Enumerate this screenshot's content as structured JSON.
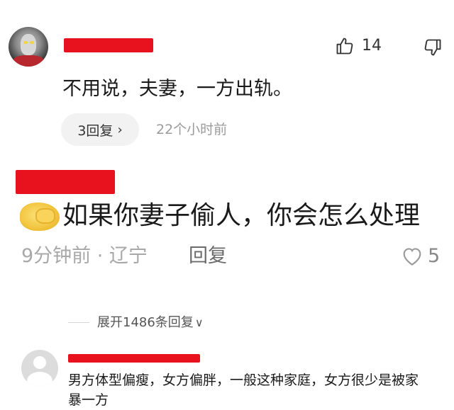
{
  "comment_top": {
    "username": "",
    "likes": "14",
    "text": "不用说，夫妻，一方出轨。",
    "reply_count_label": "3回复",
    "time": "22个小时前"
  },
  "comment_main": {
    "username": "",
    "text": "如果你妻子偷人，你会怎么处理",
    "meta": "9分钟前 · 辽宁",
    "reply_label": "回复",
    "likes": "5"
  },
  "expand_replies": {
    "label": "展开1486条回复"
  },
  "reply": {
    "username": "",
    "text": "男方体型偏瘦，女方偏胖，一般这种家庭，女方很少是被家暴一方"
  },
  "colors": {
    "redaction": "#e8121f",
    "muted_text": "#9b9b9b",
    "pill_bg": "#f2f2f2"
  },
  "icons": [
    "thumbs-up-icon",
    "thumbs-down-icon",
    "chevron-right-icon",
    "heart-icon",
    "chevron-down-icon",
    "emoji-icon",
    "default-avatar-icon"
  ]
}
